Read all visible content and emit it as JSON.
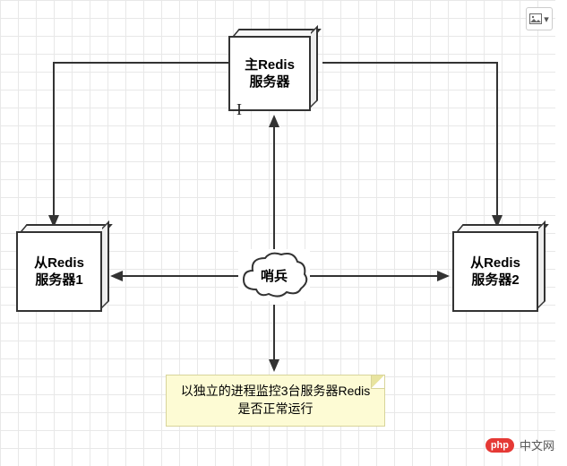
{
  "nodes": {
    "master": {
      "line1": "主Redis",
      "line2": "服务器"
    },
    "slave1": {
      "line1": "从Redis",
      "line2": "服务器1"
    },
    "slave2": {
      "line1": "从Redis",
      "line2": "服务器2"
    },
    "sentinel": "哨兵",
    "note": "以独立的进程监控3台服务器Redis是否正常运行"
  },
  "watermark": {
    "logo": "php",
    "text": "中文网"
  },
  "toolbar": {
    "image_menu": "▾"
  }
}
